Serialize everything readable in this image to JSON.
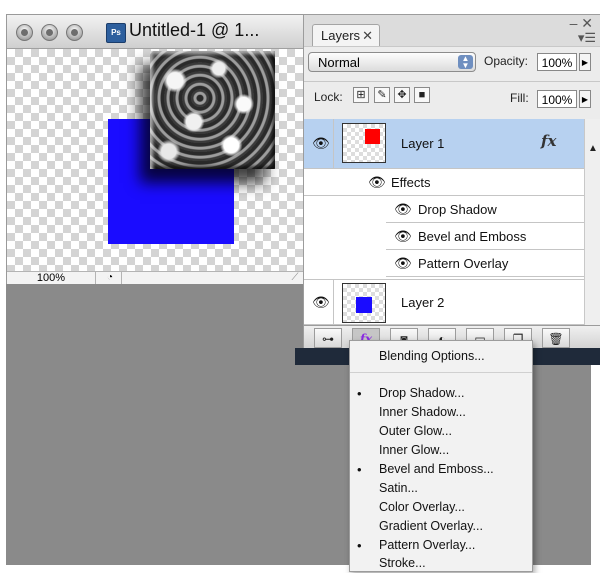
{
  "document": {
    "title": "Untitled-1 @ 1...",
    "app_icon_text": "Ps",
    "zoom": "100%"
  },
  "layers_panel": {
    "tab_label": "Layers",
    "blend_mode": "Normal",
    "opacity_label": "Opacity:",
    "opacity_value": "100%",
    "lock_label": "Lock:",
    "fill_label": "Fill:",
    "fill_value": "100%",
    "layers": [
      {
        "name": "Layer 1",
        "fx": "fx",
        "thumb_color": "#ff0000",
        "selected": true
      },
      {
        "name": "Layer 2",
        "thumb_color": "#1a0cff",
        "selected": false
      }
    ],
    "effects_header": "Effects",
    "effects": [
      "Drop Shadow",
      "Bevel and Emboss",
      "Pattern Overlay"
    ],
    "bottom_fx_label": "fx"
  },
  "fx_menu": {
    "items": [
      {
        "label": "Blending Options...",
        "checked": false
      },
      {
        "label": "Drop Shadow...",
        "checked": true
      },
      {
        "label": "Inner Shadow...",
        "checked": false
      },
      {
        "label": "Outer Glow...",
        "checked": false
      },
      {
        "label": "Inner Glow...",
        "checked": false
      },
      {
        "label": "Bevel and Emboss...",
        "checked": true
      },
      {
        "label": "Satin...",
        "checked": false
      },
      {
        "label": "Color Overlay...",
        "checked": false
      },
      {
        "label": "Gradient Overlay...",
        "checked": false
      },
      {
        "label": "Pattern Overlay...",
        "checked": true
      },
      {
        "label": "Stroke...",
        "checked": false
      }
    ]
  },
  "colors": {
    "selection_bg": "#b7d1f0",
    "canvas_blue": "#1a0cff",
    "layer1_red": "#ff0000"
  }
}
